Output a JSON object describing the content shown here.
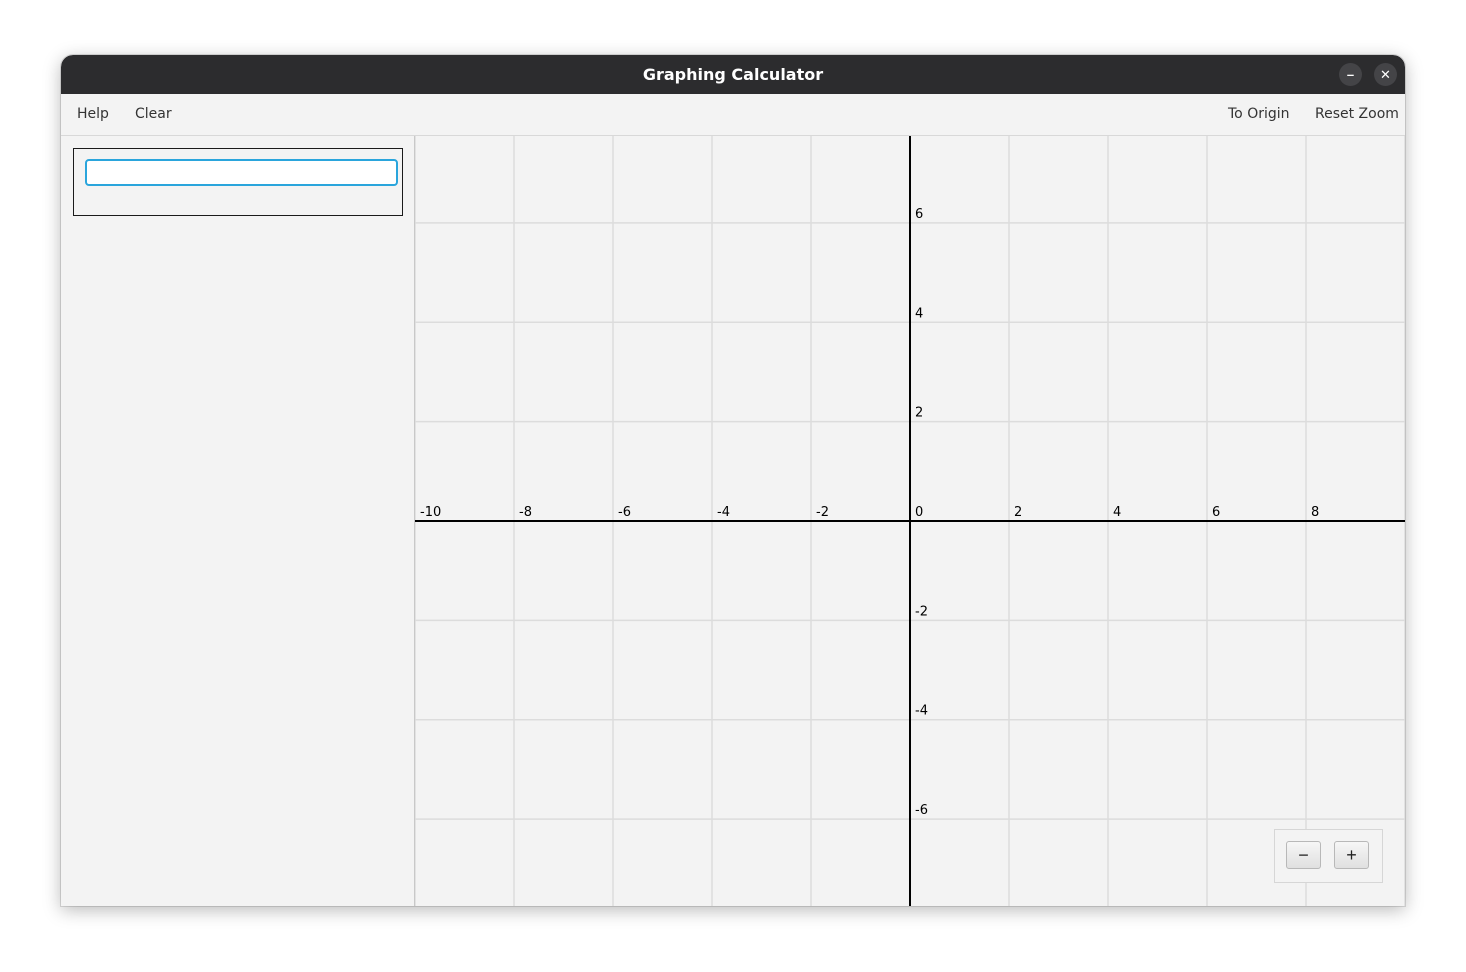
{
  "window": {
    "title": "Graphing Calculator",
    "minimize_glyph": "–",
    "close_glyph": "✕"
  },
  "menubar": {
    "left": [
      "Help",
      "Clear"
    ],
    "right": [
      "To Origin",
      "Reset Zoom"
    ]
  },
  "sidebar": {
    "expression_value": ""
  },
  "graph": {
    "x_range": [
      -10,
      10
    ],
    "y_range": [
      -7.75,
      7.75
    ],
    "grid_step": 1,
    "label_step": 2,
    "x_tick_labels": [
      "-10",
      "-8",
      "-6",
      "-4",
      "-2",
      "0",
      "2",
      "4",
      "6",
      "8"
    ],
    "y_tick_labels": [
      "6",
      "4",
      "2",
      "-2",
      "-4",
      "-6"
    ],
    "colors": {
      "background": "#f3f3f3",
      "grid": "#dcdcdc",
      "axis": "#000000"
    }
  },
  "zoom": {
    "out_label": "−",
    "in_label": "+"
  }
}
